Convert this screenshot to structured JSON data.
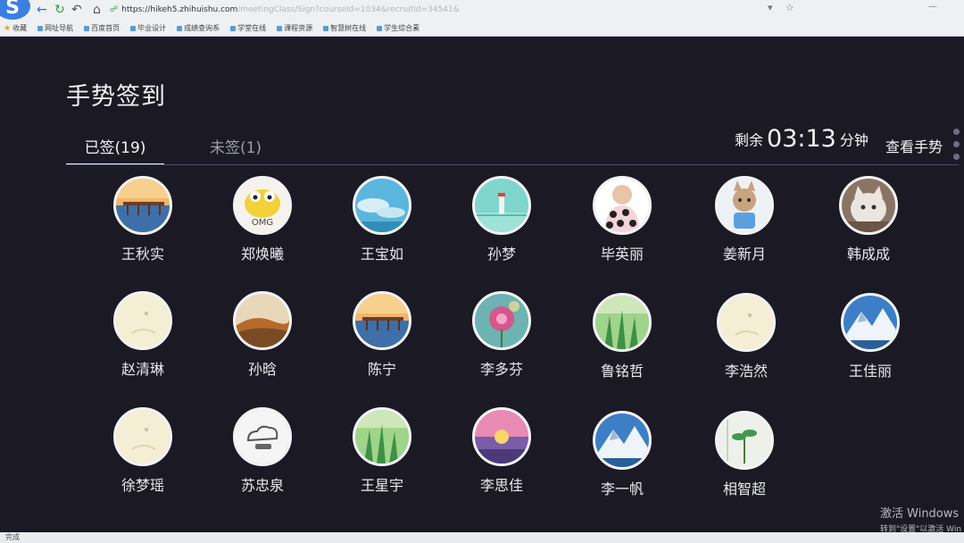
{
  "browser": {
    "url": "https://hike h5.zhihuishu.com/meetingClass/SignIn?courseId=1034&recruitId=34541&",
    "url_prefix": "https://hikeh5.zhihuishu.com",
    "url_rest": "/meetingClass/Sign?courseId=1034&recruitId=34541&",
    "bookmarks": [
      {
        "label": "收藏",
        "icon": "star-icon"
      },
      {
        "label": "网址导航",
        "icon": "globe-icon"
      },
      {
        "label": "百度首页",
        "icon": "page-icon"
      },
      {
        "label": "毕业设计",
        "icon": "page-icon"
      },
      {
        "label": "成绩查询系",
        "icon": "page-icon"
      },
      {
        "label": "学堂在线",
        "icon": "page-icon"
      },
      {
        "label": "课程资源",
        "icon": "page-icon"
      },
      {
        "label": "智慧树在线",
        "icon": "page-icon"
      },
      {
        "label": "学生综合素",
        "icon": "page-icon"
      }
    ]
  },
  "page": {
    "title": "手势签到",
    "tabs": {
      "signed": "已签(19)",
      "unsigned": "未签(1)"
    },
    "timer": {
      "prefix": "剩余",
      "time": "03:13",
      "suffix": "分钟"
    },
    "view_gesture": "查看手势"
  },
  "students": [
    {
      "name": "王秋实",
      "avatar": "pier-sunset"
    },
    {
      "name": "郑焕曦",
      "avatar": "omg-frog"
    },
    {
      "name": "王宝如",
      "avatar": "blue-sky"
    },
    {
      "name": "孙梦",
      "avatar": "teal-lighthouse"
    },
    {
      "name": "毕英丽",
      "avatar": "polka-girl"
    },
    {
      "name": "姜新月",
      "avatar": "anime-cat"
    },
    {
      "name": "韩成成",
      "avatar": "cat-photo"
    },
    {
      "name": "赵清琳",
      "avatar": "pale-cream"
    },
    {
      "name": "孙晗",
      "avatar": "autumn-field"
    },
    {
      "name": "陈宁",
      "avatar": "pier-sunset"
    },
    {
      "name": "李多芬",
      "avatar": "pink-flower"
    },
    {
      "name": "鲁铭哲",
      "avatar": "green-grass"
    },
    {
      "name": "李浩然",
      "avatar": "pale-cream"
    },
    {
      "name": "王佳丽",
      "avatar": "snow-mountain"
    },
    {
      "name": "徐梦瑶",
      "avatar": "pale-cream"
    },
    {
      "name": "苏忠泉",
      "avatar": "cloud-sketch"
    },
    {
      "name": "王星宇",
      "avatar": "green-grass"
    },
    {
      "name": "李思佳",
      "avatar": "pink-sunset"
    },
    {
      "name": "李一帆",
      "avatar": "snow-mountain"
    },
    {
      "name": "相智超",
      "avatar": "green-plant"
    }
  ],
  "watermark": {
    "line1": "激活 Windows",
    "line2": "转到\"设置\"以激活 Win"
  },
  "statusbar": {
    "text": "完成"
  },
  "colors": {
    "background": "#1b1a24",
    "text": "#f1f2f6",
    "muted_tab": "#9d9fae",
    "divider": "#4a4c66"
  }
}
